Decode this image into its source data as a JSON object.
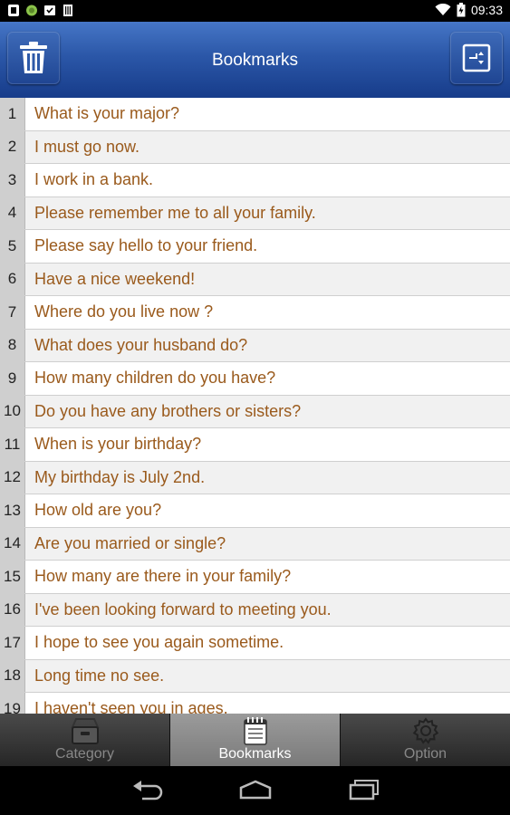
{
  "status_bar": {
    "time": "09:33",
    "left_icons": [
      "screenshot-icon",
      "android-icon",
      "download-done-icon",
      "sd-card-icon"
    ],
    "right_icons": [
      "wifi-icon",
      "battery-icon"
    ]
  },
  "app_bar": {
    "title": "Bookmarks",
    "left_button_icon": "trash-icon",
    "right_button_icon": "sort-icon"
  },
  "bookmarks": [
    {
      "num": "1",
      "text": "What is your major?"
    },
    {
      "num": "2",
      "text": "I must go now."
    },
    {
      "num": "3",
      "text": "I work in a bank."
    },
    {
      "num": "4",
      "text": "Please remember me to all your family."
    },
    {
      "num": "5",
      "text": "Please say hello to your friend."
    },
    {
      "num": "6",
      "text": "Have a nice weekend!"
    },
    {
      "num": "7",
      "text": "Where do you live now ?"
    },
    {
      "num": "8",
      "text": "What does your husband do?"
    },
    {
      "num": "9",
      "text": "How many children do you have?"
    },
    {
      "num": "10",
      "text": "Do you have any brothers or sisters?"
    },
    {
      "num": "11",
      "text": "When is your birthday?"
    },
    {
      "num": "12",
      "text": "My birthday is July 2nd."
    },
    {
      "num": "13",
      "text": "How old are you?"
    },
    {
      "num": "14",
      "text": "Are you married or single?"
    },
    {
      "num": "15",
      "text": "How many are there in your family?"
    },
    {
      "num": "16",
      "text": "I've been looking forward to meeting you."
    },
    {
      "num": "17",
      "text": "I hope to see you again sometime."
    },
    {
      "num": "18",
      "text": "Long time no see."
    },
    {
      "num": "19",
      "text": "I haven't seen you in ages."
    }
  ],
  "tabs": [
    {
      "label": "Category",
      "icon": "box-icon",
      "active": false
    },
    {
      "label": "Bookmarks",
      "icon": "notepad-icon",
      "active": true
    },
    {
      "label": "Option",
      "icon": "gear-icon",
      "active": false
    }
  ],
  "nav_bar": {
    "icons": [
      "back-icon",
      "home-icon",
      "recent-apps-icon"
    ]
  }
}
